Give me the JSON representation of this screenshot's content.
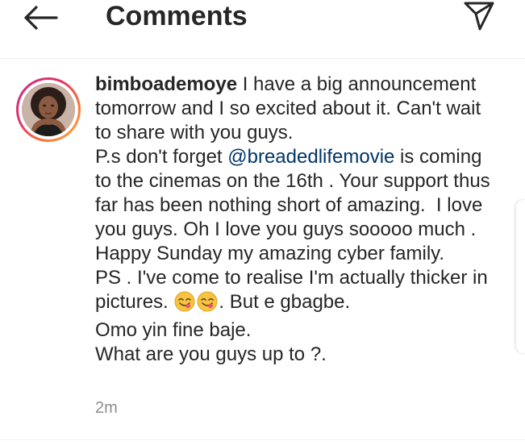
{
  "header": {
    "title": "Comments",
    "back_icon": "arrow-left-icon",
    "send_icon": "send-paper-plane-icon"
  },
  "comment": {
    "username": "bimboademoye",
    "text_parts": [
      " I have a big announcement tomorrow and I so excited about it. Can't wait to share with you guys.\nP.s don't forget ",
      " is coming to the cinemas on the 16th . Your support thus far has been nothing short of amazing.  I love you guys. Oh I love you guys sooooo much .\nHappy Sunday my amazing cyber family.\nPS . I've come to realise I'm actually thicker in pictures. ",
      ". But e gbagbe.\nOmo yin fine baje.\nWhat are you guys up to ?."
    ],
    "mention": "@breadedlifemovie",
    "emoji": [
      "face-savoring-food-emoji",
      "face-savoring-food-emoji"
    ],
    "timestamp": "2m",
    "avatar": "profile-photo"
  },
  "colors": {
    "text": "#262626",
    "mention": "#003569",
    "muted": "#8e8e8e",
    "story_ring": [
      "#c13584",
      "#e1306c",
      "#f77737",
      "#fcaf45"
    ]
  }
}
